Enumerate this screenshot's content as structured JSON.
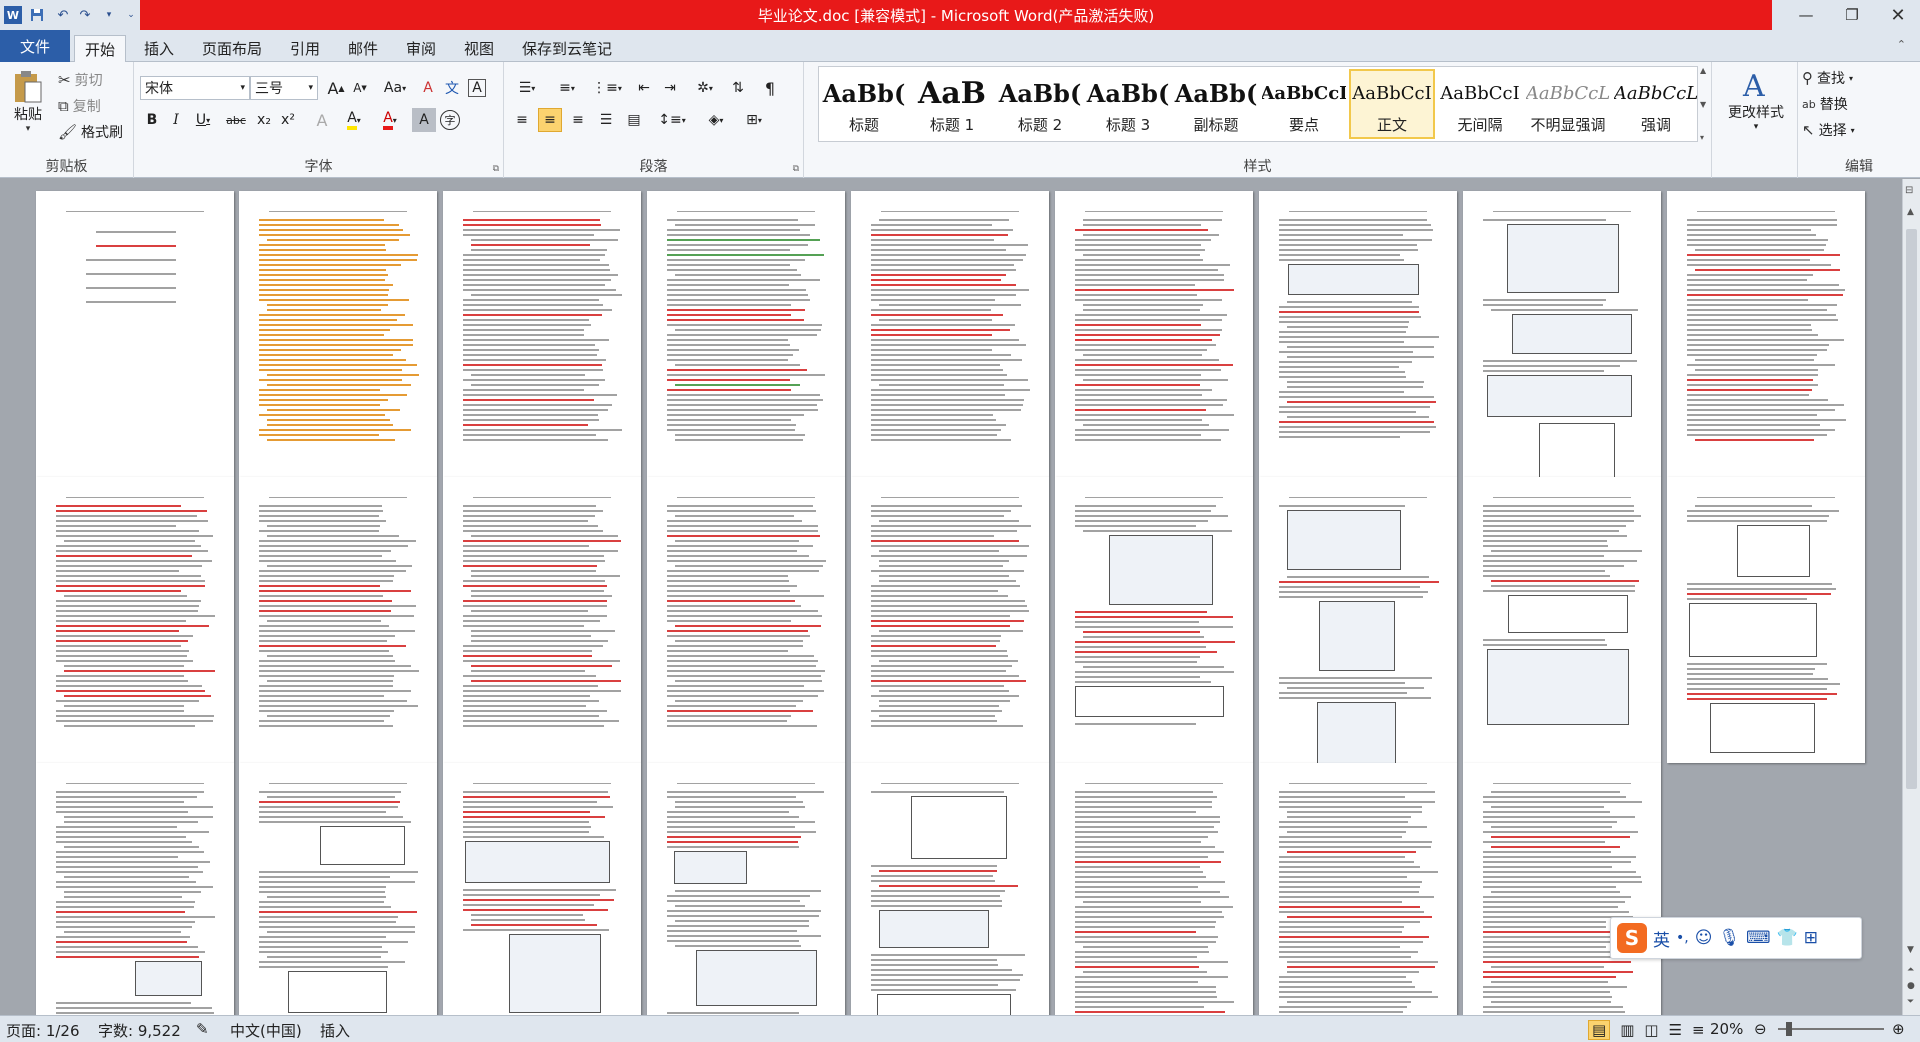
{
  "window": {
    "title": "毕业论文.doc [兼容模式] - Microsoft Word(产品激活失败)",
    "app_icon": "word-icon",
    "qat": [
      "save-icon",
      "undo-icon",
      "redo-icon",
      "customize-icon"
    ]
  },
  "tabs": [
    "文件",
    "开始",
    "插入",
    "页面布局",
    "引用",
    "邮件",
    "审阅",
    "视图",
    "保存到云笔记"
  ],
  "active_tab": "开始",
  "clipboard": {
    "paste": "粘贴",
    "cut": "剪切",
    "copy": "复制",
    "format_painter": "格式刷",
    "label": "剪贴板"
  },
  "font": {
    "name": "宋体",
    "size": "三号",
    "label": "字体",
    "bold": "B",
    "italic": "I",
    "underline": "U",
    "strike": "abc",
    "sub": "x₂",
    "sup": "x²",
    "grow": "A",
    "shrink": "A",
    "case": "Aa",
    "clear": "A",
    "char_border": "A",
    "highlight": "A",
    "color": "A",
    "shade": "A",
    "enclose": "字"
  },
  "paragraph": {
    "label": "段落"
  },
  "styles": {
    "label": "样式",
    "items": [
      {
        "sample": "AaBb(",
        "name": "标题"
      },
      {
        "sample": "AaB",
        "name": "标题 1"
      },
      {
        "sample": "AaBb(",
        "name": "标题 2"
      },
      {
        "sample": "AaBb(",
        "name": "标题 3"
      },
      {
        "sample": "AaBb(",
        "name": "副标题"
      },
      {
        "sample": "AaBbCcI",
        "name": "要点"
      },
      {
        "sample": "AaBbCcI",
        "name": "正文"
      },
      {
        "sample": "AaBbCcI",
        "name": "无间隔"
      },
      {
        "sample": "AaBbCcL",
        "name": "不明显强调"
      },
      {
        "sample": "AaBbCcL",
        "name": "强调"
      }
    ],
    "selected": "正文",
    "change": "更改样式"
  },
  "editing": {
    "find": "查找",
    "replace": "替换",
    "select": "选择",
    "label": "编辑"
  },
  "status": {
    "page": "页面: 1/26",
    "words": "字数: 9,522",
    "language": "中文(中国)",
    "mode": "插入",
    "zoom": "20%"
  },
  "ime": {
    "lang": "英",
    "logo": "S"
  },
  "colors": {
    "title_bar": "#e81919",
    "file_tab": "#2c5ea8",
    "accent": "#2c5ea8"
  }
}
